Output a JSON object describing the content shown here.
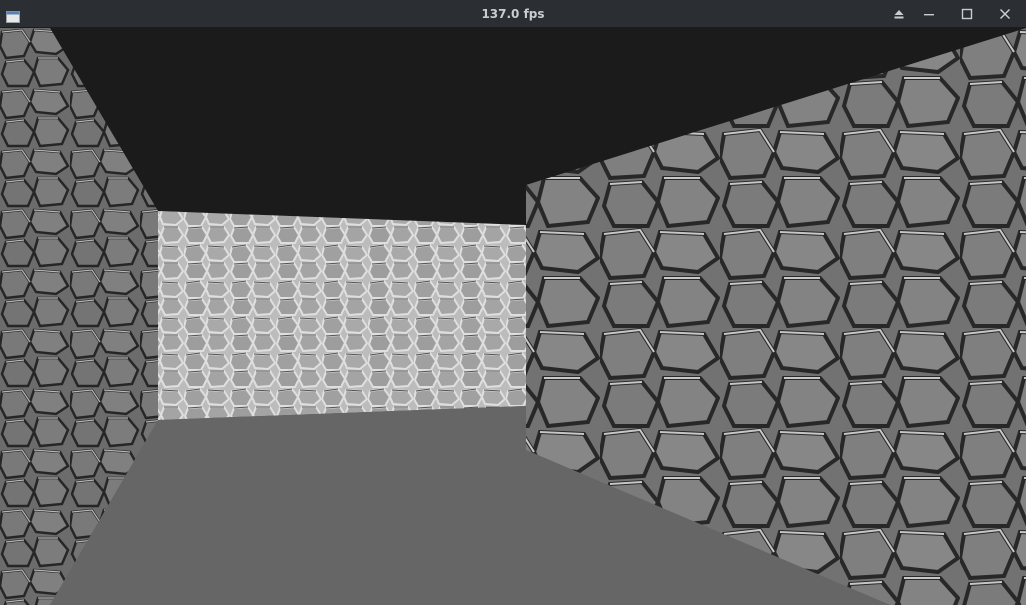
{
  "window": {
    "title": "137.0 fps",
    "buttons": {
      "shade": "eject-icon",
      "minimize": "minimize-icon",
      "maximize": "maximize-icon",
      "close": "close-icon"
    }
  },
  "scene": {
    "ceiling_color": "#1b1b1b",
    "floor_color": "#666666",
    "wall_texture": "cobblestone",
    "left_wall_shade": "#6f6f6f",
    "far_wall_shade": "#9a9a9a",
    "right_wall_shade": "#7a7a7a",
    "crack_dark": "#2a2a2a",
    "crack_light": "#d8d8d8"
  }
}
